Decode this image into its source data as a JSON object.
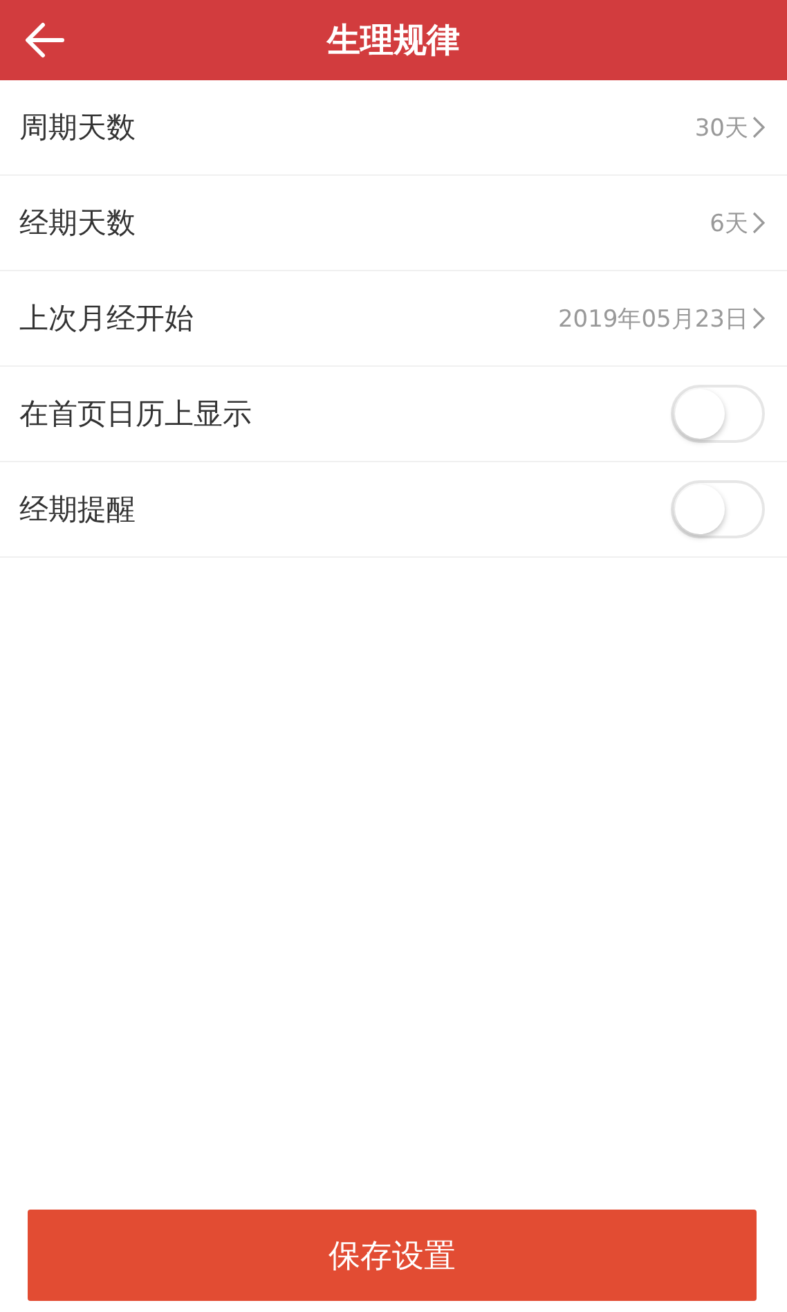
{
  "header": {
    "title": "生理规律"
  },
  "rows": [
    {
      "kind": "value",
      "label": "周期天数",
      "value": "30天"
    },
    {
      "kind": "value",
      "label": "经期天数",
      "value": "6天"
    },
    {
      "kind": "value",
      "label": "上次月经开始",
      "value": "2019年05月23日"
    },
    {
      "kind": "toggle",
      "label": "在首页日历上显示",
      "on": false
    },
    {
      "kind": "toggle",
      "label": "经期提醒",
      "on": false
    }
  ],
  "save_button": {
    "label": "保存设置"
  }
}
